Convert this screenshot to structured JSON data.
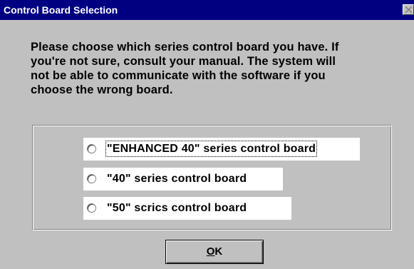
{
  "window": {
    "title": "Control Board Selection",
    "close_icon": "close-x-icon"
  },
  "message": {
    "text": "Please choose which series control board you have.  If\nyou're not sure, consult your manual.  The system will\nnot be able to communicate with the software if you\nchoose the wrong board."
  },
  "options": [
    {
      "label": "\"ENHANCED 40\" series control board",
      "selected": false,
      "focused": true
    },
    {
      "label": "\"40\" series control board",
      "selected": false,
      "focused": false
    },
    {
      "label": "\"50\" scrics control board",
      "selected": false,
      "focused": false
    }
  ],
  "buttons": {
    "ok_mnemonic": "O",
    "ok_rest": "K"
  },
  "colors": {
    "titlebar": "#000080",
    "face": "#c0c0c0",
    "option_bg": "#ffffff"
  }
}
